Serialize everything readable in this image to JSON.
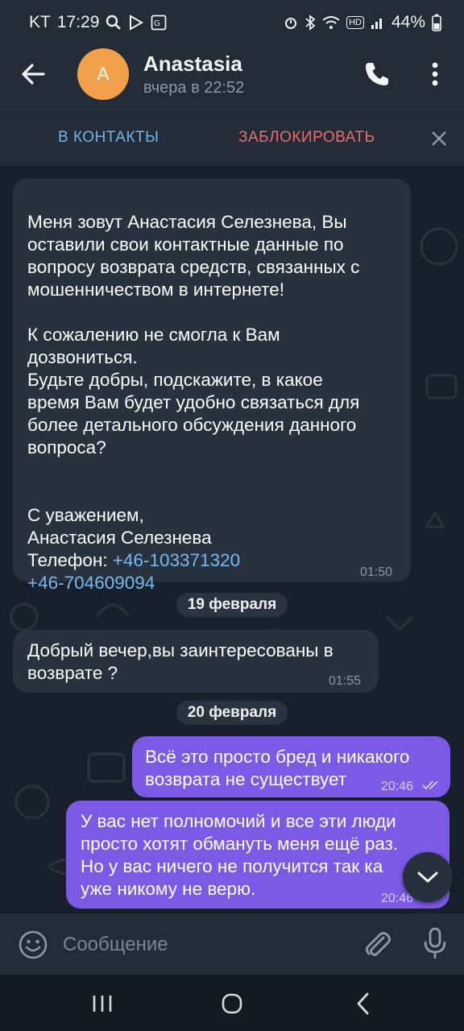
{
  "status_bar": {
    "carrier": "KT",
    "time": "17:29",
    "battery": "44%",
    "hd_label": "HD"
  },
  "header": {
    "avatar_letter": "A",
    "name": "Anastasia",
    "last_seen": "вчера в 22:52",
    "avatar_color": "#f0a14a"
  },
  "action_bar": {
    "add_contact": "В КОНТАКТЫ",
    "block": "ЗАБЛОКИРОВАТЬ"
  },
  "messages": [
    {
      "direction": "in",
      "text": "Меня зовут Анастасия Селезнева, Вы\nоставили свои контактные данные по\nвопросу возврата средств, связанных с\nмошенничеством в интернете!\n\nК сожалению не смогла к Вам\nдозвониться.\nБудьте добры, подскажите, в какое\nвремя Вам будет удобно связаться для\nболее детального обсуждения данного\nвопроса?\n\n\nС уважением,\nАнастасия Селезнева",
      "phone_label": "Телефон: ",
      "phone1": "+46-103371320",
      "phone2": "+46-704609094",
      "time": "01:50"
    },
    {
      "direction": "in",
      "text": "Добрый вечер,вы заинтересованы в\nвозврате ?",
      "time": "01:55"
    },
    {
      "direction": "out",
      "text": "Всё это просто бред и никакого\nвозврата не существует",
      "time": "20:46"
    },
    {
      "direction": "out",
      "text": "У вас нет полномочий и все эти люди\nпросто хотят обмануть меня ещё раз.\nНо у вас ничего не получится так ка\nуже никому не верю.",
      "time": "20:46"
    }
  ],
  "dates": [
    "19 февраля",
    "20 февраля"
  ],
  "composer": {
    "placeholder": "Сообщение"
  },
  "colors": {
    "outgoing_bubble": "#7c5ae6",
    "incoming_bubble": "#28323f",
    "link": "#78b8f0",
    "block_red": "#ec6c6c",
    "accent_blue": "#6fb6f0"
  }
}
